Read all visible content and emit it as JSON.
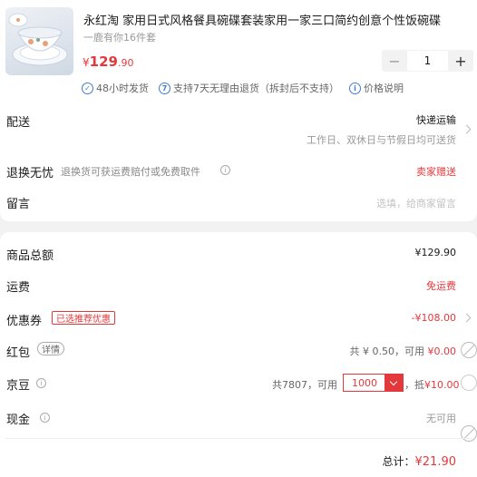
{
  "product": {
    "title": "永红淘 家用日式风格餐具碗碟套装家用一家三口简约创意个性饭碗碟",
    "spec": "一鹿有你16件套",
    "price_symbol": "¥",
    "price_int": "129",
    "price_dec": ".90",
    "quantity": "1",
    "minus": "−",
    "plus": "+"
  },
  "services": [
    {
      "icon": "✓",
      "label": "48小时发货"
    },
    {
      "icon": "7",
      "label": "支持7天无理由退货（拆封后不支持）"
    },
    {
      "icon": "i",
      "label": "价格说明"
    }
  ],
  "delivery": {
    "label": "配送",
    "method": "快递运输",
    "time": "工作日、双休日与节假日均可送货"
  },
  "returns": {
    "label": "退换无忧",
    "desc": "退换货可获运费赔付或免费取件",
    "value": "卖家赠送"
  },
  "message": {
    "label": "留言",
    "placeholder": "选填，给商家留言"
  },
  "summary": {
    "goods_total_label": "商品总额",
    "goods_total": "¥129.90",
    "shipping_label": "运费",
    "shipping": "免运费",
    "coupon_label": "优惠券",
    "coupon_badge": "已选推荐优惠",
    "coupon_value": "-¥108.00",
    "redpacket_label": "红包",
    "redpacket_detail": "详情",
    "redpacket_info": "共 ¥ 0.50，可用",
    "redpacket_value": "¥0.00",
    "beans_label": "京豆",
    "beans_info": "共7807，可用",
    "beans_input": "1000",
    "beans_deduct_prefix": "，抵",
    "beans_deduct": "¥10.00",
    "cash_label": "现金",
    "cash_value": "无可用",
    "total_label": "总计：",
    "total": "¥21.90"
  },
  "colors": {
    "accent": "#e4393c",
    "info_blue": "#3f7bd8"
  },
  "icons": [
    "product-thumbnail",
    "check-circle-icon",
    "seven-day-icon",
    "info-icon",
    "chevron-right-icon",
    "chevron-down-icon",
    "radio-icon"
  ]
}
